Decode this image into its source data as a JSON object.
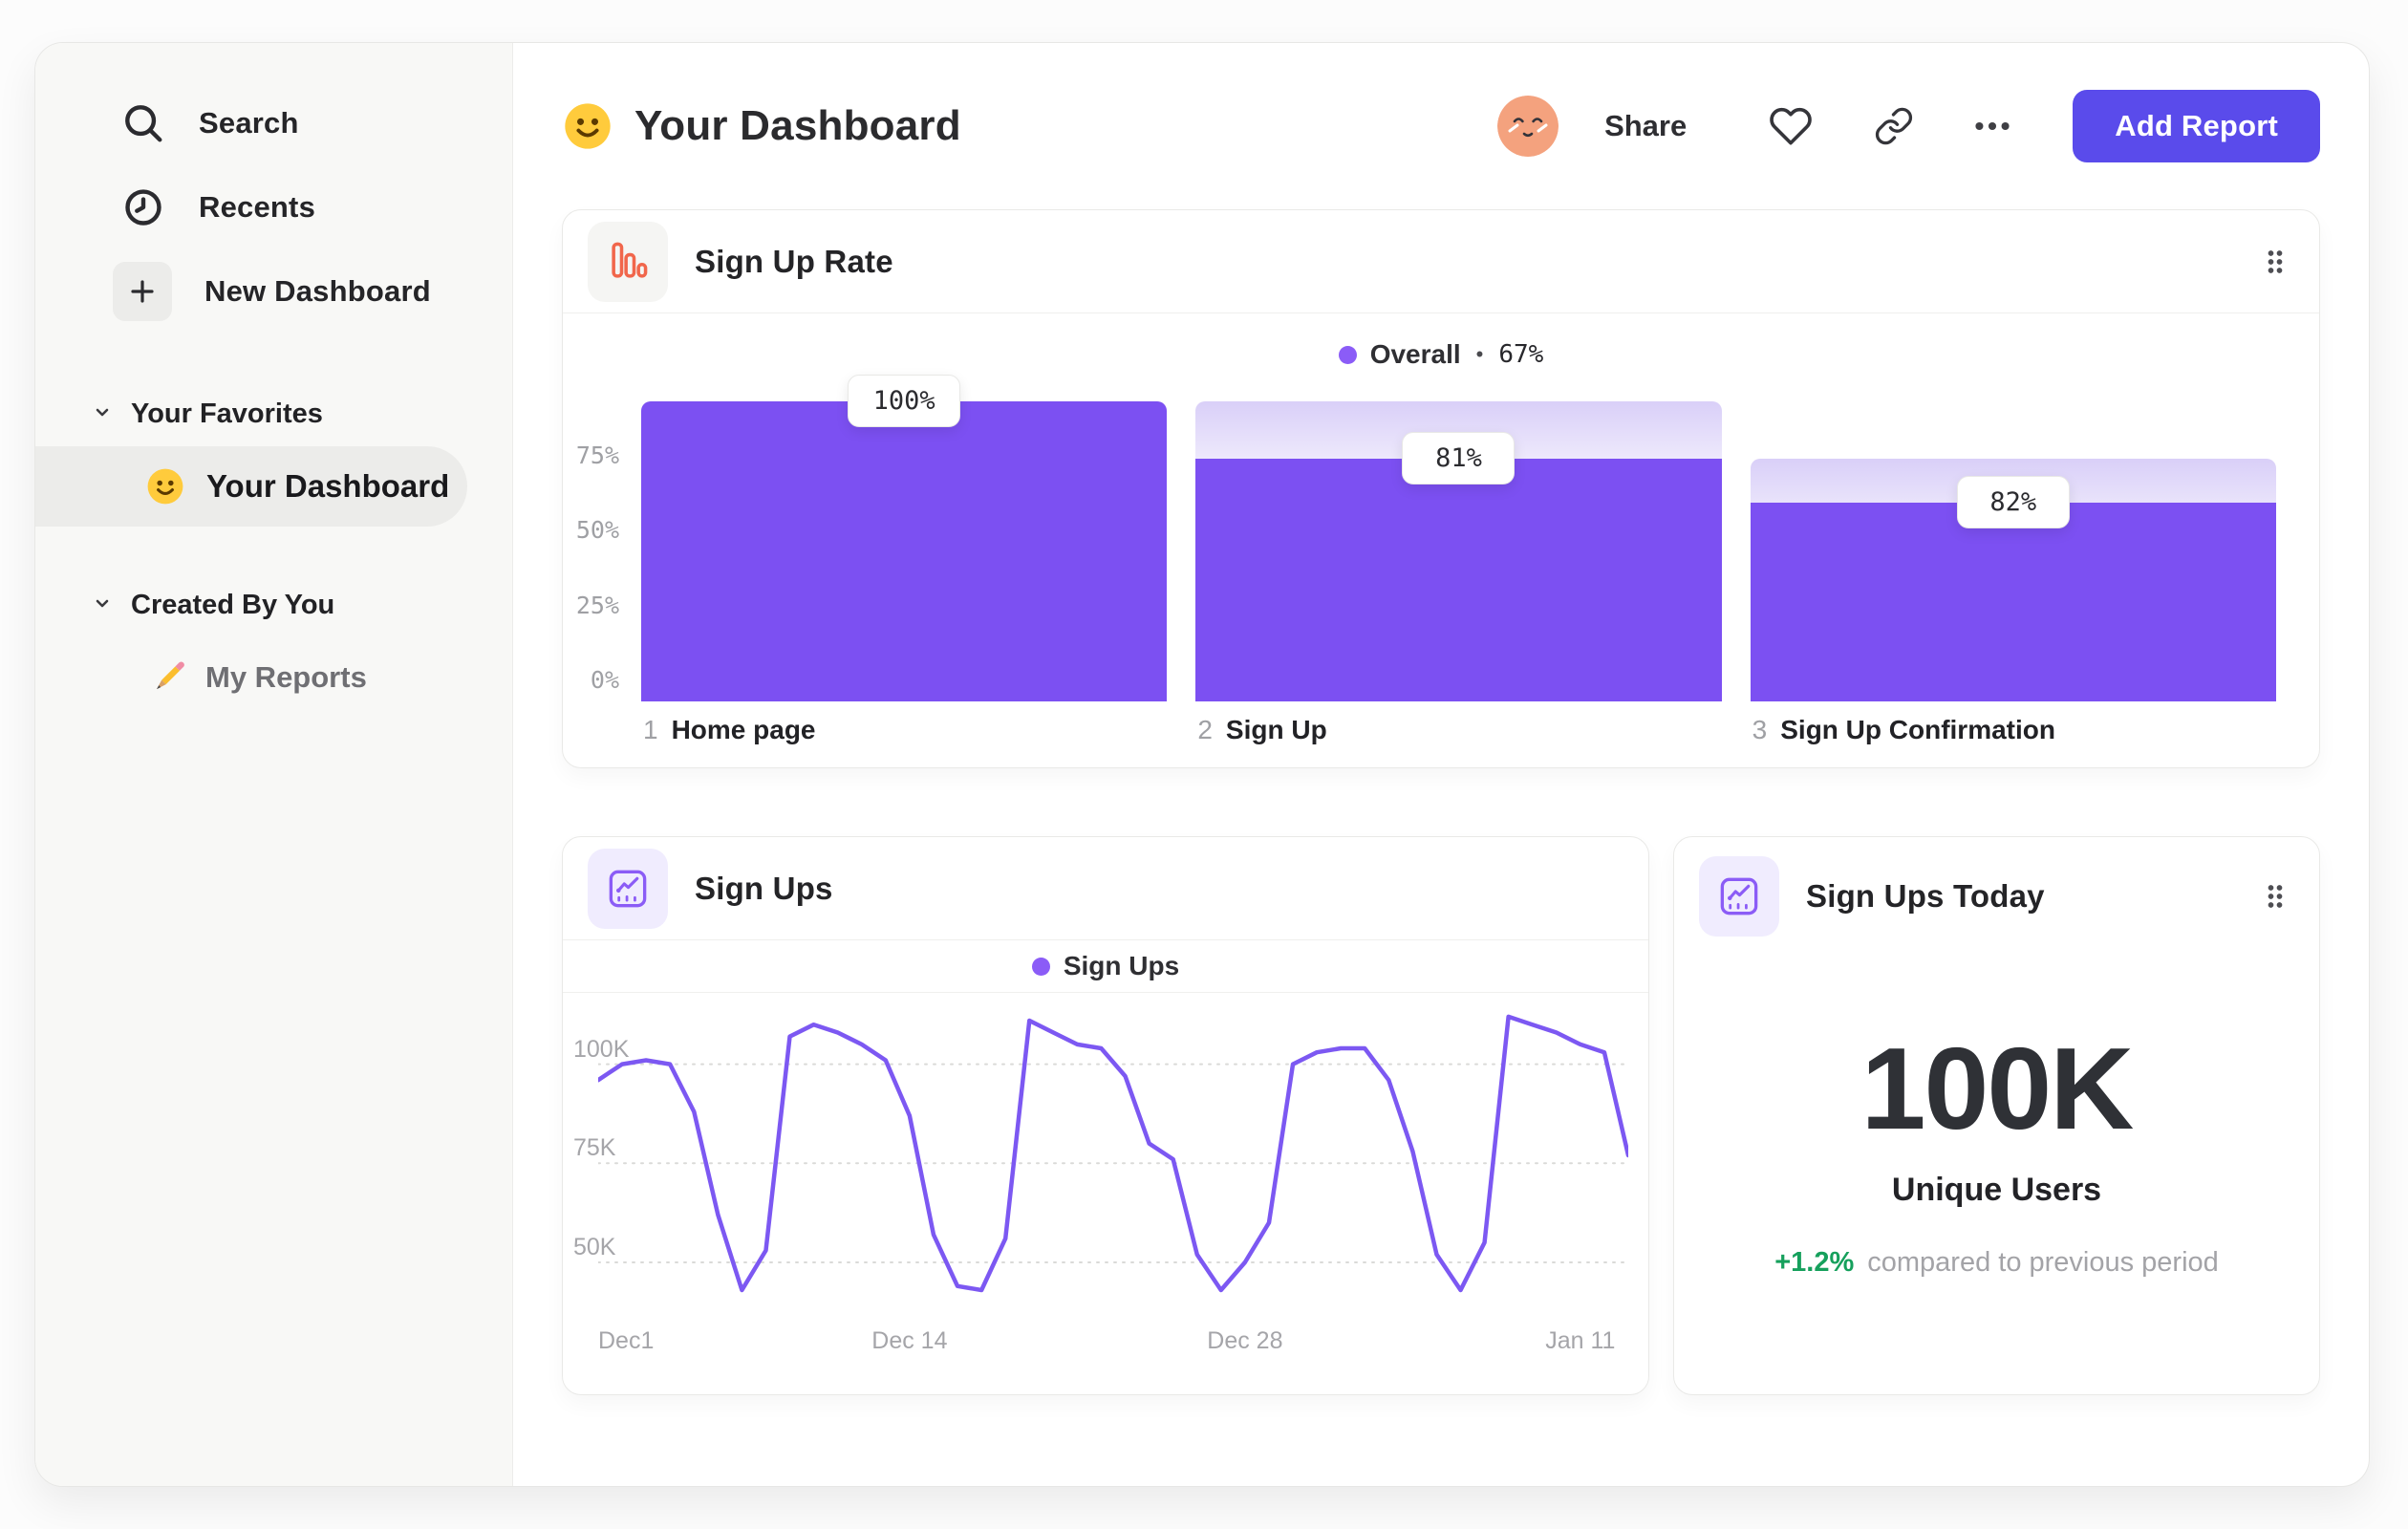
{
  "colors": {
    "accent_purple": "#7C50F2",
    "legend_dot_purple": "#8B5CF7",
    "line_purple": "#7C58F2",
    "ghost_gradient_top": "#D9CFF8",
    "button_purple": "#5A4BEB",
    "positive_green": "#16A05C",
    "funnel_icon_orange": "#F1664B",
    "line_icon_purple": "#8B5CF6",
    "avatar_peach": "#F4A27E",
    "sidebar_bg": "#F8F8F6"
  },
  "sidebar": {
    "items": [
      {
        "label": "Search",
        "icon": "search-icon"
      },
      {
        "label": "Recents",
        "icon": "clock-icon"
      },
      {
        "label": "New Dashboard",
        "icon": "plus-icon"
      }
    ],
    "sections": [
      {
        "label": "Your Favorites",
        "icon": "chevron-down-icon",
        "items": [
          {
            "label": "Your Dashboard",
            "icon": "smiley-emoji",
            "selected": true
          }
        ]
      },
      {
        "label": "Created By You",
        "icon": "chevron-down-icon",
        "items": [
          {
            "label": "My Reports",
            "icon": "pencil-emoji",
            "selected": false
          }
        ]
      }
    ]
  },
  "header": {
    "title_emoji": "smiley-emoji",
    "title": "Your Dashboard",
    "avatar": "avatar",
    "share_label": "Share",
    "icons": [
      "heart-icon",
      "link-icon",
      "ellipsis-icon"
    ],
    "add_report_label": "Add Report"
  },
  "chart_data": [
    {
      "type": "bar",
      "variant": "funnel",
      "title": "Sign Up Rate",
      "icon": "funnel-chart-icon",
      "legend_position": "top-center",
      "legend_label": "Overall",
      "legend_sep": "•",
      "legend_value": "67%",
      "overall_conversion_pct": 67,
      "categories": [
        "Home page",
        "Sign Up",
        "Sign Up Confirmation"
      ],
      "step_numbers": [
        "1",
        "2",
        "3"
      ],
      "step_conversion_pct": [
        100,
        81,
        82
      ],
      "value_labels": [
        "100%",
        "81%",
        "82%"
      ],
      "solid_heights_pct": [
        100,
        81,
        66.4
      ],
      "container_heights_pct": [
        100,
        100,
        81
      ],
      "ylim": [
        0,
        100
      ],
      "grid": false,
      "y_ticks": [
        {
          "label": "75%",
          "value": 75
        },
        {
          "label": "50%",
          "value": 50
        },
        {
          "label": "25%",
          "value": 25
        },
        {
          "label": "0%",
          "value": 0
        }
      ]
    },
    {
      "type": "line",
      "title": "Sign Ups",
      "icon": "line-chart-icon",
      "legend_position": "top-center",
      "legend": [
        "Sign Ups"
      ],
      "line_color": "#7C58F2",
      "grid": "horizontal-dashed",
      "unit": "K users",
      "ylim": [
        36,
        118
      ],
      "y_ticks": [
        {
          "label": "100K",
          "value": 100
        },
        {
          "label": "75K",
          "value": 75
        },
        {
          "label": "50K",
          "value": 50
        }
      ],
      "x_days_total": 43,
      "x_ticks": [
        {
          "label": "Dec1",
          "day": 0
        },
        {
          "label": "Dec 14",
          "day": 13
        },
        {
          "label": "Dec 28",
          "day": 27
        },
        {
          "label": "Jan 11",
          "day": 41
        }
      ],
      "values_k": [
        96,
        100,
        101,
        100,
        88,
        62,
        43,
        53,
        107,
        110,
        108,
        105,
        101,
        87,
        57,
        44,
        43,
        56,
        111,
        108,
        105,
        104,
        97,
        80,
        76,
        52,
        43,
        50,
        60,
        100,
        103,
        104,
        104,
        96,
        78,
        52,
        43,
        55,
        112,
        110,
        108,
        105,
        103,
        77
      ]
    },
    {
      "type": "big-number",
      "title": "Sign Ups Today",
      "icon": "line-chart-icon",
      "value": "100K",
      "label": "Unique Users",
      "delta": "+1.2%",
      "delta_note": "compared to previous period"
    }
  ]
}
